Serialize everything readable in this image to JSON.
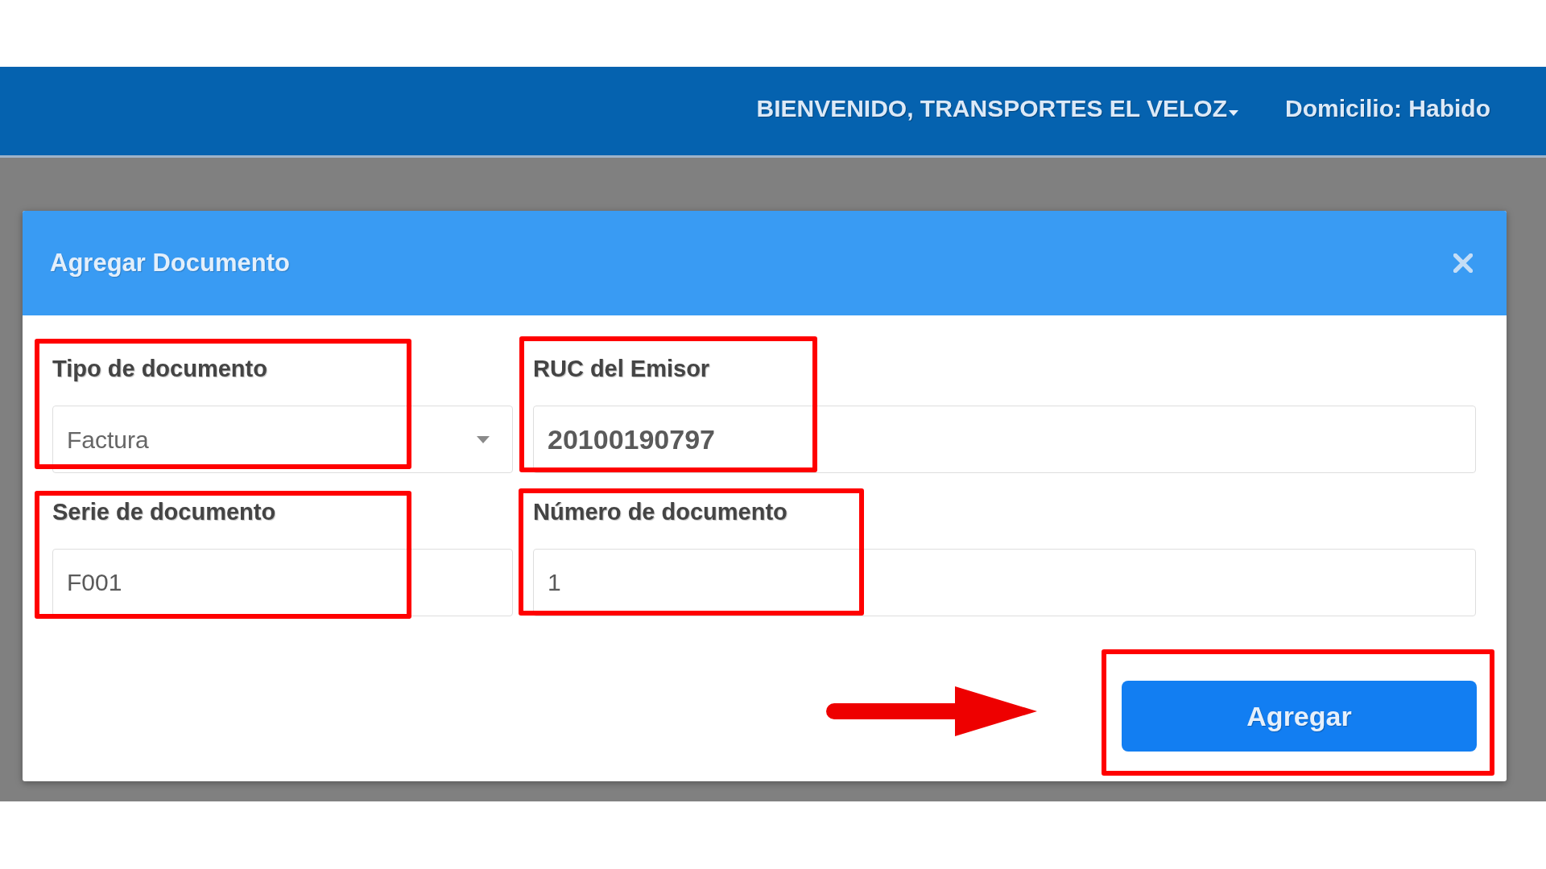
{
  "header": {
    "welcome": "BIENVENIDO, TRANSPORTES EL VELOZ",
    "status": "Domicilio: Habido"
  },
  "dialog": {
    "title": "Agregar Documento",
    "fields": [
      {
        "kind": "select",
        "label": "Tipo de documento",
        "value": "Factura",
        "highlighted": true
      },
      {
        "kind": "text",
        "label": "RUC del Emisor",
        "value": "20100190797",
        "highlighted": true
      },
      {
        "kind": "text",
        "label": "Serie de documento",
        "value": "F001",
        "highlighted": true
      },
      {
        "kind": "text",
        "label": "Número de documento",
        "value": "1",
        "highlighted": true
      }
    ],
    "submit": {
      "label": "Agregar",
      "highlighted": true,
      "pointer_arrow": true
    }
  }
}
